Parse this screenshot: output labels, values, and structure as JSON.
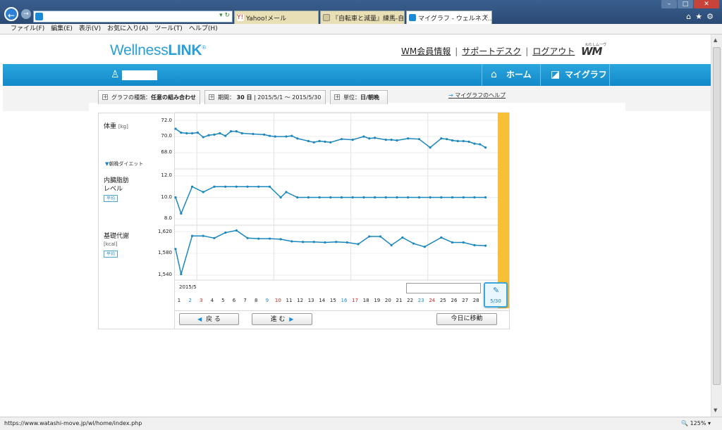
{
  "browser": {
    "address": "",
    "tabs": [
      {
        "label": "Yahoo!メール",
        "color": "#d1251f"
      },
      {
        "label": "『自転車と減量』練馬-自転...",
        "color": "#6a6a6a"
      },
      {
        "label": "マイグラフ - ウェルネス...",
        "close": "×",
        "color": "#1a8ad6"
      }
    ],
    "menu": [
      "ファイル(F)",
      "編集(E)",
      "表示(V)",
      "お気に入り(A)",
      "ツール(T)",
      "ヘルプ(H)"
    ],
    "status_url": "https://www.watashi-move.jp/wl/home/index.php",
    "zoom": "125%"
  },
  "site": {
    "logo_a": "Wellness",
    "logo_b": "LINK",
    "links": [
      "WM会員情報",
      "サポートデスク",
      "ログアウト"
    ],
    "link_sep": "|",
    "wm_kana": "わたしムーヴ",
    "wm_mark": "WM",
    "nav": {
      "home": "ホーム",
      "mygraph": "マイグラフ"
    }
  },
  "controls": {
    "graph_type_label": "グラフの種類：",
    "graph_type_value": "任意の組み合わせ",
    "period_label": "期間：",
    "period_days": "30 日",
    "period_range": "2015/5/1 〜 2015/5/30",
    "unit_label": "単位：",
    "unit_value": "日/朝晩",
    "help": "マイグラフのヘルプ"
  },
  "rows": [
    {
      "title": "体重",
      "unit": "[kg]",
      "ticks": [
        "72.0",
        "70.0",
        "68.0"
      ],
      "note": "朝晩ダイエット"
    },
    {
      "title": "内臓脂肪",
      "title2": "レベル",
      "ticks": [
        "12.0",
        "10.0",
        "8.0"
      ],
      "tag": "平均"
    },
    {
      "title": "基礎代謝",
      "unit": "[kcal]",
      "ticks": [
        "1,620",
        "1,580",
        "1,540"
      ],
      "tag": "平均"
    }
  ],
  "xaxis": {
    "month": "2015/5",
    "days": [
      "1",
      "2",
      "3",
      "4",
      "5",
      "6",
      "7",
      "8",
      "9",
      "10",
      "11",
      "12",
      "13",
      "14",
      "15",
      "16",
      "17",
      "18",
      "19",
      "20",
      "21",
      "22",
      "23",
      "24",
      "25",
      "26",
      "27",
      "28"
    ],
    "blue_days": [
      "2",
      "9",
      "16",
      "23"
    ],
    "red_days": [
      "3",
      "10",
      "17",
      "24"
    ]
  },
  "selected_date": "5/30",
  "buttons": {
    "back": "戻 る",
    "next": "進 む",
    "today": "今日に移動",
    "back_arrow": "◀",
    "next_arrow": "▶"
  },
  "chart_data": [
    {
      "type": "line",
      "title": "体重",
      "ylabel": "[kg]",
      "ylim": [
        67.5,
        72.5
      ],
      "x": [
        1,
        1.5,
        2,
        2.5,
        3,
        3.5,
        4,
        4.5,
        5,
        5.5,
        6,
        6.5,
        7,
        8,
        9,
        9.5,
        10,
        11,
        11.5,
        12,
        13,
        13.5,
        14,
        14.5,
        15,
        16,
        17,
        18,
        18.5,
        19,
        20,
        20.5,
        21,
        22,
        23,
        24,
        25,
        25.5,
        26,
        26.5,
        27,
        27.5,
        28,
        28.5,
        29
      ],
      "y": [
        71.2,
        70.6,
        70.5,
        70.5,
        70.6,
        69.9,
        70.2,
        70.3,
        70.5,
        70.1,
        70.8,
        70.8,
        70.5,
        70.4,
        70.3,
        70.1,
        70.0,
        70.0,
        70.1,
        69.7,
        69.3,
        69.1,
        69.3,
        69.2,
        69.1,
        69.6,
        69.5,
        70.0,
        69.7,
        69.8,
        69.5,
        69.5,
        69.4,
        69.7,
        69.6,
        68.3,
        69.7,
        69.6,
        69.4,
        69.3,
        69.3,
        69.2,
        68.9,
        68.8,
        68.3
      ]
    },
    {
      "type": "line",
      "title": "内臓脂肪レベル",
      "ylim": [
        8.0,
        12.0
      ],
      "x": [
        1,
        1.5,
        2.5,
        3.5,
        4.5,
        5.5,
        6.5,
        7.5,
        8.5,
        9.5,
        10.5,
        11,
        12,
        13,
        14,
        15,
        16,
        17,
        18,
        19,
        20,
        21,
        22,
        23,
        24,
        25,
        26,
        27,
        28,
        29
      ],
      "y": [
        10.0,
        8.5,
        11.0,
        10.5,
        11.0,
        11.0,
        11.0,
        11.0,
        11.0,
        11.0,
        10.0,
        10.5,
        10.0,
        10.0,
        10.0,
        10.0,
        10.0,
        10.0,
        10.0,
        10.0,
        10.0,
        10.0,
        10.0,
        10.0,
        10.0,
        10.0,
        10.0,
        10.0,
        10.0,
        10.0
      ]
    },
    {
      "type": "line",
      "title": "基礎代謝",
      "ylabel": "[kcal]",
      "ylim": [
        1540,
        1620
      ],
      "x": [
        1,
        1.5,
        2.5,
        3.5,
        4.5,
        5.5,
        6.5,
        7.5,
        8.5,
        9.5,
        10.5,
        11.5,
        12.5,
        13.5,
        14.5,
        15.5,
        16.5,
        17.5,
        18.5,
        19.5,
        20.5,
        21.5,
        22.5,
        23.5,
        25,
        26,
        27,
        28,
        29
      ],
      "y": [
        1588,
        1542,
        1612,
        1612,
        1608,
        1618,
        1622,
        1608,
        1607,
        1607,
        1606,
        1602,
        1601,
        1601,
        1600,
        1601,
        1600,
        1597,
        1611,
        1611,
        1595,
        1609,
        1598,
        1592,
        1609,
        1600,
        1600,
        1595,
        1594
      ]
    }
  ]
}
